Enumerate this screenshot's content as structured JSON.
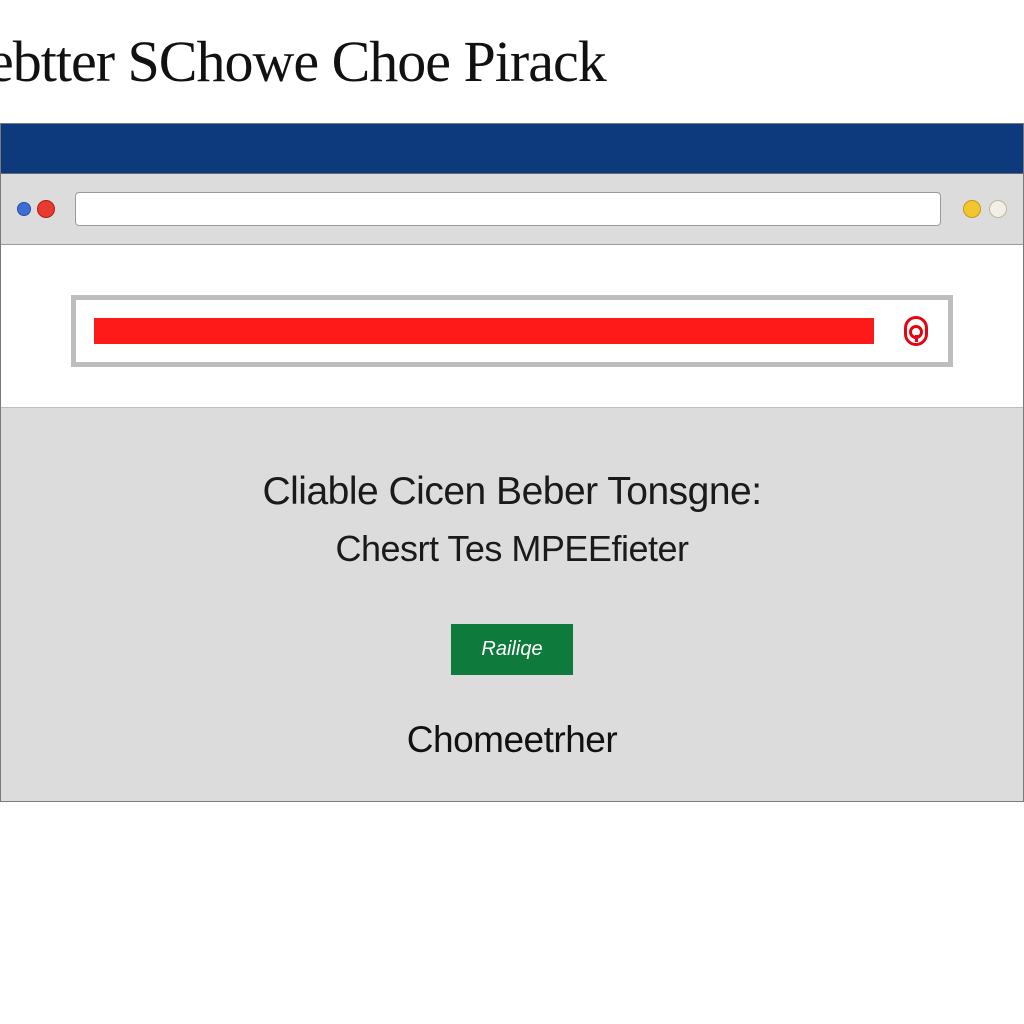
{
  "page": {
    "title": "ebtter SChowe Choe Pirack"
  },
  "toolbar": {
    "url_value": ""
  },
  "search": {
    "value": ""
  },
  "content": {
    "line1": "Cliable Cicen Beber Tonsgne:",
    "line2": "Chesrt Tes MPEEfieter",
    "button_label": "Railiqe",
    "footer": "Chomeetrher"
  },
  "colors": {
    "header_bar": "#0c3a7d",
    "chrome_bg": "#dcdcdc",
    "search_fill": "#ff1a1a",
    "lock_red": "#e30613",
    "button_green": "#0e7a3b"
  }
}
